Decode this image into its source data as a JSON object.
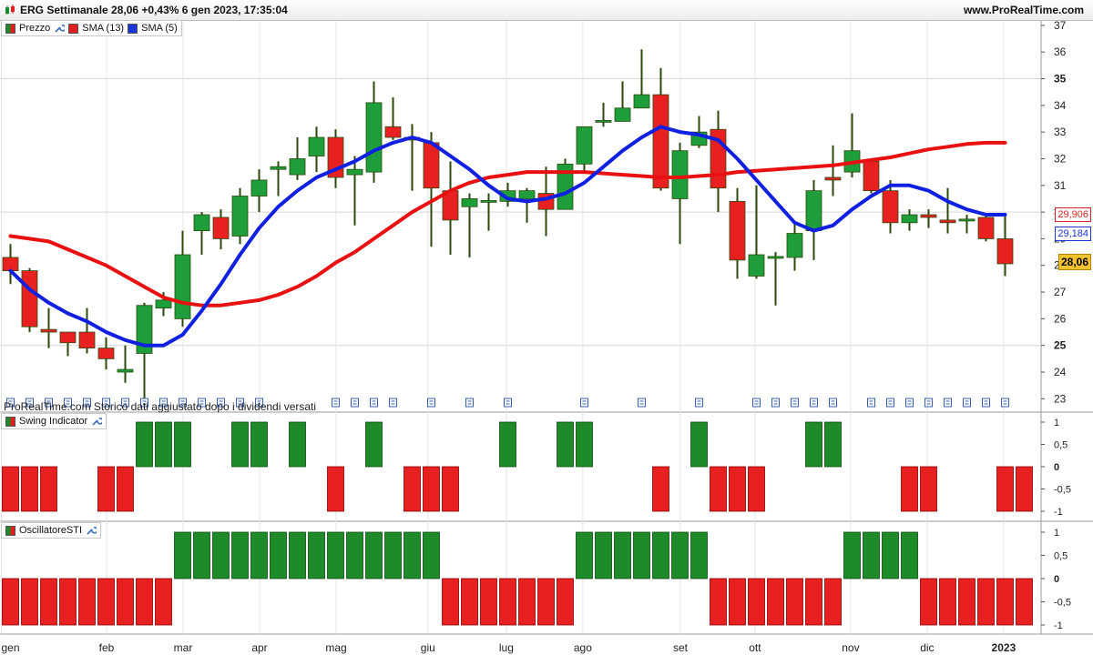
{
  "header": {
    "title": "ERG Settimanale 28,06 +0,43% 6 gen 2023, 17:35:04",
    "site": "www.ProRealTime.com"
  },
  "legends": {
    "price": "Prezzo",
    "sma13": "SMA (13)",
    "sma5": "SMA (5)",
    "swing": "Swing Indicator",
    "osc": "OscillatoreSTI"
  },
  "note": "ProRealTime.com Storico dati aggiustato dopo i dividendi versati",
  "tags": {
    "sma13": "29,906",
    "sma5": "29,184",
    "last": "28,06"
  },
  "colors": {
    "up": "#1e9e3a",
    "down": "#e82020",
    "sma13": "#e81010",
    "sma5": "#1020e0"
  },
  "chart_data": [
    {
      "type": "candlestick",
      "title": "Prezzo",
      "y_ticks": [
        23,
        24,
        25,
        26,
        27,
        28,
        29,
        30,
        31,
        32,
        33,
        34,
        35,
        36,
        37
      ],
      "ylim": [
        22.5,
        37.2
      ],
      "x_ticks": [
        "gen",
        "feb",
        "mar",
        "apr",
        "mag",
        "giu",
        "lug",
        "ago",
        "set",
        "ott",
        "nov",
        "dic",
        "2023"
      ],
      "x_tick_weeks": [
        0,
        5.5,
        9.5,
        13.5,
        17.5,
        22.3,
        26.4,
        30.4,
        35.5,
        39.4,
        44.4,
        48.4,
        52.4
      ],
      "ohlc": [
        [
          28.3,
          28.8,
          27.3,
          27.8
        ],
        [
          27.8,
          27.9,
          25.5,
          25.7
        ],
        [
          25.6,
          26.4,
          24.9,
          25.5
        ],
        [
          25.5,
          25.5,
          24.6,
          25.1
        ],
        [
          25.5,
          26.4,
          24.7,
          24.9
        ],
        [
          24.9,
          25.3,
          24.1,
          24.5
        ],
        [
          24.0,
          25.0,
          23.6,
          24.1
        ],
        [
          24.7,
          26.6,
          23.0,
          26.5
        ],
        [
          26.4,
          27.0,
          26.1,
          26.7
        ],
        [
          26.0,
          29.3,
          25.7,
          28.4
        ],
        [
          29.3,
          30.0,
          28.4,
          29.9
        ],
        [
          29.8,
          30.1,
          28.6,
          29.0
        ],
        [
          29.1,
          30.9,
          28.8,
          30.6
        ],
        [
          30.6,
          31.6,
          30.0,
          31.2
        ],
        [
          31.6,
          31.9,
          30.6,
          31.7
        ],
        [
          31.4,
          32.8,
          31.2,
          32.0
        ],
        [
          32.1,
          33.2,
          31.5,
          32.8
        ],
        [
          32.8,
          33.1,
          30.9,
          31.3
        ],
        [
          31.4,
          32.1,
          29.5,
          31.6
        ],
        [
          31.5,
          34.9,
          31.1,
          34.1
        ],
        [
          33.2,
          34.3,
          32.7,
          32.8
        ],
        [
          32.8,
          33.3,
          30.8,
          32.7
        ],
        [
          32.6,
          33.0,
          28.7,
          30.9
        ],
        [
          30.8,
          31.9,
          28.4,
          29.7
        ],
        [
          30.2,
          30.7,
          28.3,
          30.5
        ],
        [
          30.4,
          30.7,
          29.3,
          30.4
        ],
        [
          30.4,
          31.1,
          30.2,
          30.8
        ],
        [
          30.5,
          30.9,
          29.6,
          30.8
        ],
        [
          30.7,
          31.7,
          29.1,
          30.1
        ],
        [
          30.1,
          32.0,
          30.2,
          31.8
        ],
        [
          31.8,
          33.2,
          31.5,
          33.2
        ],
        [
          33.4,
          34.1,
          33.2,
          33.4
        ],
        [
          33.4,
          34.9,
          33.4,
          33.9
        ],
        [
          33.9,
          36.1,
          33.9,
          34.4
        ],
        [
          34.4,
          35.4,
          30.8,
          30.9
        ],
        [
          30.5,
          32.6,
          28.8,
          32.3
        ],
        [
          32.5,
          33.6,
          32.4,
          33.0
        ],
        [
          33.1,
          33.8,
          30.0,
          30.9
        ],
        [
          30.4,
          30.9,
          27.5,
          28.2
        ],
        [
          27.6,
          31.0,
          27.5,
          28.4
        ],
        [
          28.3,
          28.5,
          26.5,
          28.3
        ],
        [
          28.3,
          29.6,
          27.8,
          29.2
        ],
        [
          29.3,
          31.2,
          28.2,
          30.8
        ],
        [
          31.3,
          32.5,
          30.6,
          31.2
        ],
        [
          31.5,
          33.7,
          31.3,
          32.3
        ],
        [
          31.9,
          32.0,
          30.7,
          30.8
        ],
        [
          30.8,
          31.2,
          29.2,
          29.6
        ],
        [
          29.6,
          30.1,
          29.3,
          29.9
        ],
        [
          29.9,
          30.1,
          29.4,
          29.8
        ],
        [
          29.7,
          30.9,
          29.2,
          29.6
        ],
        [
          29.7,
          29.9,
          29.2,
          29.7
        ],
        [
          29.8,
          29.9,
          28.9,
          29.0
        ],
        [
          29.0,
          29.9,
          27.6,
          28.06
        ]
      ],
      "sma13": [
        29.1,
        29.0,
        28.9,
        28.6,
        28.3,
        28.0,
        27.6,
        27.2,
        26.8,
        26.6,
        26.5,
        26.5,
        26.6,
        26.7,
        26.9,
        27.2,
        27.6,
        28.1,
        28.5,
        29.0,
        29.5,
        30.0,
        30.4,
        30.8,
        31.1,
        31.3,
        31.4,
        31.5,
        31.5,
        31.5,
        31.5,
        31.45,
        31.4,
        31.35,
        31.3,
        31.3,
        31.35,
        31.4,
        31.5,
        31.55,
        31.6,
        31.65,
        31.7,
        31.75,
        31.85,
        31.95,
        32.05,
        32.2,
        32.35,
        32.45,
        32.55,
        32.6,
        32.6
      ],
      "sma5": [
        27.8,
        27.1,
        26.6,
        26.2,
        25.9,
        25.5,
        25.2,
        25.0,
        25.0,
        25.4,
        26.3,
        27.3,
        28.4,
        29.4,
        30.2,
        30.8,
        31.3,
        31.6,
        31.9,
        32.3,
        32.6,
        32.8,
        32.6,
        32.1,
        31.6,
        31.0,
        30.5,
        30.4,
        30.5,
        30.7,
        31.1,
        31.7,
        32.3,
        32.8,
        33.2,
        33.0,
        32.9,
        32.7,
        32.0,
        31.2,
        30.4,
        29.6,
        29.3,
        29.5,
        30.1,
        30.6,
        31.0,
        31.0,
        30.8,
        30.4,
        30.1,
        29.9,
        29.9
      ],
      "sma13_last": 29.906,
      "sma5_last": 29.184,
      "last": 28.06
    },
    {
      "type": "bar",
      "title": "Swing Indicator",
      "y_ticks": [
        "1",
        "0,5",
        "0",
        "-0,5",
        "-1"
      ],
      "ylim": [
        -1,
        1
      ],
      "values": [
        -1,
        -1,
        -1,
        0,
        0,
        -1,
        -1,
        1,
        1,
        1,
        0,
        0,
        1,
        1,
        0,
        1,
        0,
        -1,
        0,
        1,
        0,
        -1,
        -1,
        -1,
        0,
        0,
        1,
        0,
        0,
        1,
        1,
        0,
        0,
        0,
        -1,
        0,
        1,
        -1,
        -1,
        -1,
        0,
        0,
        1,
        1,
        0,
        0,
        0,
        -1,
        -1,
        0,
        0,
        0,
        -1,
        -1
      ]
    },
    {
      "type": "bar",
      "title": "OscillatoreSTI",
      "y_ticks": [
        "1",
        "0,5",
        "0",
        "-0,5",
        "-1"
      ],
      "ylim": [
        -1,
        1
      ],
      "values": [
        -1,
        -1,
        -1,
        -1,
        -1,
        -1,
        -1,
        -1,
        -1,
        1,
        1,
        1,
        1,
        1,
        1,
        1,
        1,
        1,
        1,
        1,
        1,
        1,
        1,
        -1,
        -1,
        -1,
        -1,
        -1,
        -1,
        -1,
        1,
        1,
        1,
        1,
        1,
        1,
        1,
        -1,
        -1,
        -1,
        -1,
        -1,
        -1,
        -1,
        1,
        1,
        1,
        1,
        -1,
        -1,
        -1,
        -1,
        -1,
        -1
      ]
    }
  ]
}
